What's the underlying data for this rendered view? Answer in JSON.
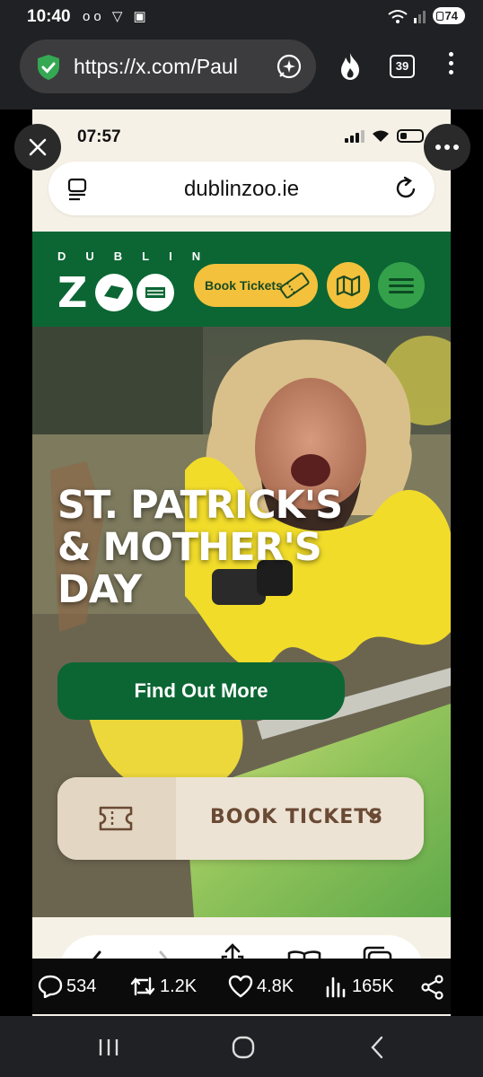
{
  "android_status": {
    "time": "10:40",
    "battery": "74"
  },
  "browser": {
    "url": "https://x.com/Paul",
    "tab_count": "39"
  },
  "phone": {
    "time": "07:57",
    "domain": "dublinzoo.ie",
    "header": {
      "logo_top": "DUBLIN",
      "logo_bottom": "ZOO",
      "book_tickets": "Book Tickets"
    },
    "hero": {
      "title": "ST. PATRICK'S & MOTHER'S DAY",
      "cta": "Find Out More"
    },
    "booking": {
      "label": "BOOK TICKETS"
    }
  },
  "x_stats": {
    "replies": "534",
    "reposts": "1.2K",
    "likes": "4.8K",
    "views": "165K"
  },
  "colors": {
    "zoo_green": "#0b6633",
    "zoo_yellow": "#f3c13c",
    "cream": "#f6f1e6"
  }
}
